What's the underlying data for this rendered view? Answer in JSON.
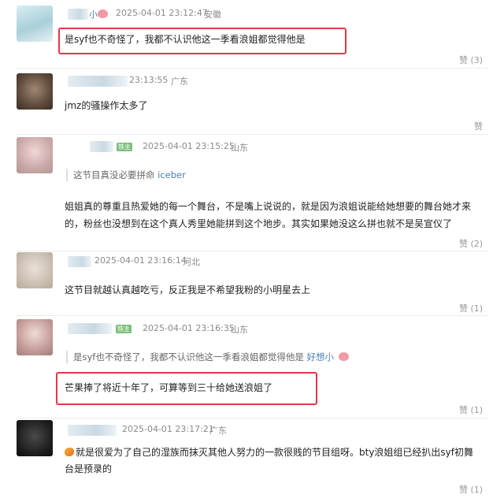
{
  "comments": [
    {
      "name_suffix": "小",
      "time": "2025-04-01 23:12:47",
      "location": "安徽",
      "text": "是syf也不奇怪了，我都不认识他这一季看浪姐都觉得他是",
      "likes": "赞 (3)"
    },
    {
      "time": "23:13:55",
      "location": "广东",
      "text": "jmz的骚操作太多了",
      "likes": "赞"
    },
    {
      "badge": "铁主",
      "time": "2025-04-01 23:15:25",
      "location": "山东",
      "quote_text": "这节目真没必要拼命",
      "quote_user": "iceber",
      "text_line1": "姐姐真的尊重且热爱她的每一个舞台，不是嘴上说说的，就是因为浪姐说能给她想要的舞台她才来",
      "text_line2": "的，粉丝也没想到在这个真人秀里她能拼到这个地步。其实如果她没这么拼也就不是吴宣仪了",
      "likes": "赞 (2)"
    },
    {
      "time": "2025-04-01 23:16:14",
      "location": "河北",
      "text": "这节目就越认真越吃亏，反正我是不希望我粉的小明星去上",
      "likes": "赞 (1)"
    },
    {
      "badge": "铁主",
      "time": "2025-04-01 23:16:35",
      "location": "山东",
      "quote_text": "是syf也不奇怪了，我都不认识他这一季看浪姐都觉得他是",
      "quote_user": "好想小",
      "text": "芒果捧了将近十年了，可算等到三十给她送浪姐了",
      "likes": "赞 (1)"
    },
    {
      "time": "2025-04-01 23:17:21",
      "location": "广东",
      "text_line1": "就是很爱为了自己的湿族而抹灭其他人努力的一款很贱的节目组呀。bty浪姐组已经扒出syf初舞",
      "text_line2": "台是预录的",
      "likes": "赞 (1)"
    }
  ],
  "colors": {
    "highlight_box": "#e0384a",
    "quote_user": "#4a7fb5",
    "meta_text": "#8a8a8a"
  }
}
